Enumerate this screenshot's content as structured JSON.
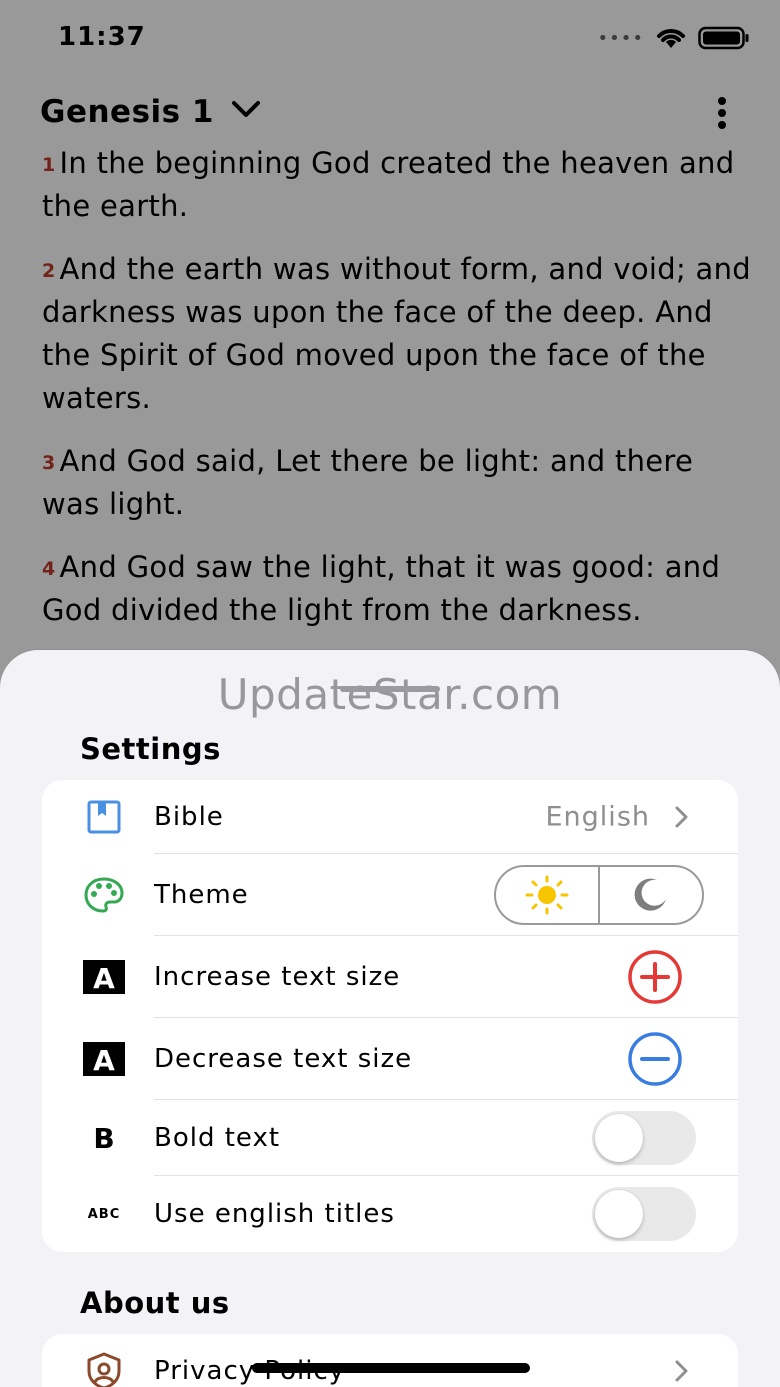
{
  "status_bar": {
    "time": "11:37"
  },
  "reader": {
    "book_title": "Genesis 1",
    "verses": [
      {
        "num": "1",
        "text": "In the beginning God created the heaven and the earth."
      },
      {
        "num": "2",
        "text": "And the earth was without form, and void; and darkness was upon the face of the deep. And the Spirit of God moved upon the face of the waters."
      },
      {
        "num": "3",
        "text": "And God said, Let there be light: and there was light."
      },
      {
        "num": "4",
        "text": "And God saw the light, that it was good: and God divided the light from the darkness."
      }
    ]
  },
  "sheet": {
    "watermark": "UpdateStar.com",
    "settings_title": "Settings",
    "settings": {
      "bible_label": "Bible",
      "bible_value": "English",
      "theme_label": "Theme",
      "increase_label": "Increase text size",
      "decrease_label": "Decrease text size",
      "bold_label": "Bold text",
      "bold_enabled": false,
      "english_titles_label": "Use english titles",
      "english_titles_enabled": false,
      "abc_glyph": "ABC",
      "a_glyph": "A",
      "b_glyph": "B"
    },
    "about_title": "About us",
    "about": {
      "privacy_label": "Privacy Policy"
    }
  },
  "colors": {
    "verse_number": "#c0392b",
    "bible_icon": "#4a90e2",
    "theme_icon": "#34a853",
    "increase": "#e53935",
    "decrease": "#3a7de0",
    "sun": "#f7c600",
    "moon": "#7d7d80",
    "privacy_icon": "#8b4a2b"
  }
}
